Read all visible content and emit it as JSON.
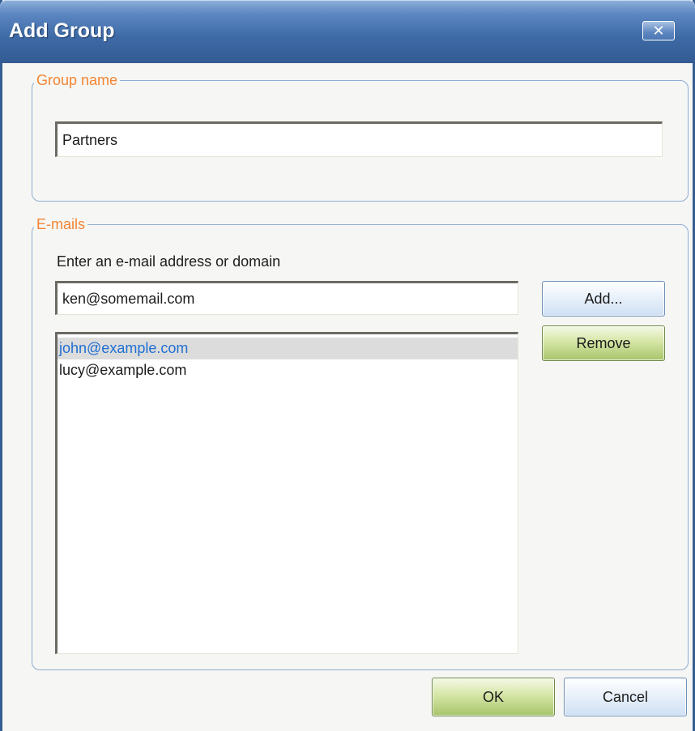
{
  "window": {
    "title": "Add Group",
    "close_symbol": "✕",
    "close_icon": "close-icon"
  },
  "group_name": {
    "legend": "Group name",
    "value": "Partners"
  },
  "emails": {
    "legend": "E-mails",
    "instruction": "Enter an e-mail address or domain",
    "input_value": "ken@somemail.com",
    "add_label": "Add...",
    "remove_label": "Remove",
    "list": [
      {
        "email": "john@example.com",
        "selected": true
      },
      {
        "email": "lucy@example.com",
        "selected": false
      }
    ]
  },
  "footer": {
    "ok_label": "OK",
    "cancel_label": "Cancel"
  },
  "colors": {
    "legend": "#f48534",
    "selected_text": "#1f6fd2",
    "titlebar": "#3e6aa6"
  }
}
